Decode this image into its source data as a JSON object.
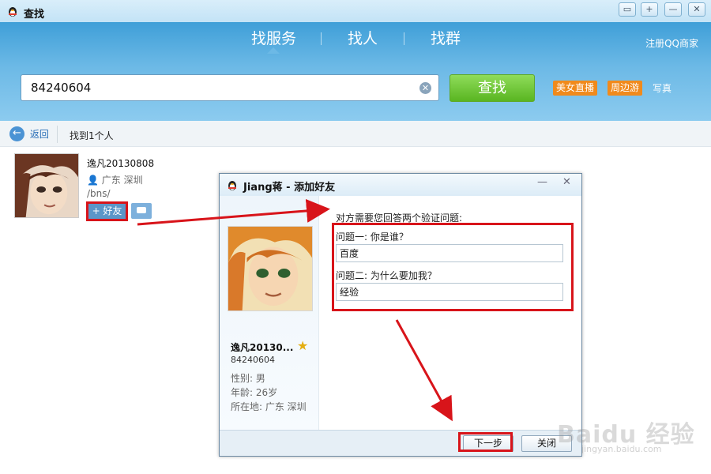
{
  "window": {
    "title": "查找",
    "controls": [
      "消息",
      "+",
      "—",
      "✕"
    ]
  },
  "header": {
    "tabs": [
      "找服务",
      "找人",
      "找群"
    ],
    "register_link": "注册QQ商家",
    "search_value": "84240604",
    "search_button": "查找",
    "tags": [
      "美女直播",
      "周边游",
      "写真"
    ]
  },
  "results_bar": {
    "back_label": "返回",
    "found_text": "找到1个人"
  },
  "result": {
    "name": "逸凡20130808",
    "location": "广东 深圳",
    "signature": "/bns/",
    "add_button": "+ 好友"
  },
  "dialog": {
    "title": "Jiang蒋 - 添加好友",
    "min_label": "—",
    "close_label": "✕",
    "profile": {
      "nickname": "逸凡20130...",
      "qq": "84240604",
      "gender": "性别: 男",
      "age": "年龄: 26岁",
      "location": "所在地: 广东  深圳"
    },
    "intro": "对方需要您回答两个验证问题:",
    "questions": [
      {
        "label": "问题一: 你是谁？",
        "answer": "百度"
      },
      {
        "label": "问题二: 为什么要加我？",
        "answer": "经验"
      }
    ],
    "next_button": "下一步",
    "close_button": "关闭"
  },
  "colors": {
    "header_blue": "#4aa6dc",
    "search_green": "#5cb825",
    "tag_orange": "#f08a1c",
    "annotation_red": "#d8141a"
  }
}
